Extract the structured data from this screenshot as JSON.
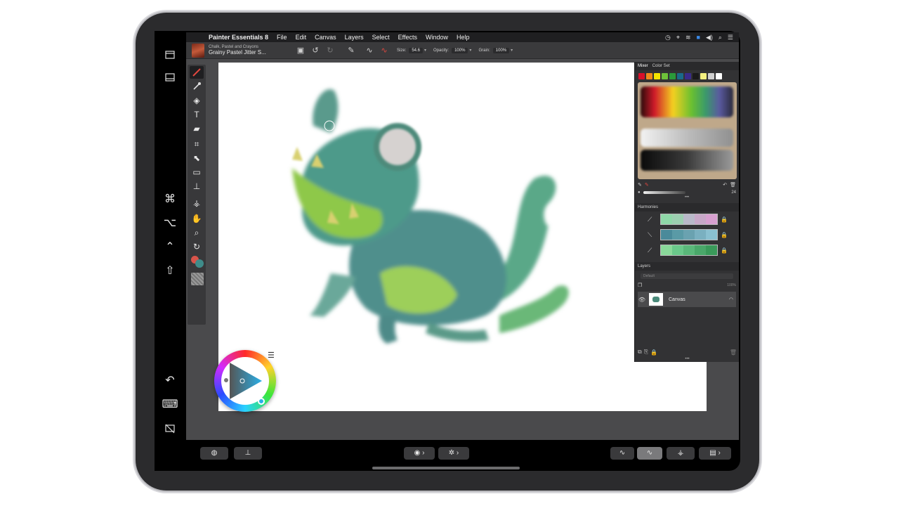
{
  "menubar": {
    "app_name": "Painter Essentials 8",
    "menus": [
      "File",
      "Edit",
      "Canvas",
      "Layers",
      "Select",
      "Effects",
      "Window",
      "Help"
    ]
  },
  "property_bar": {
    "brush_category": "Chalk, Pastel and Crayons",
    "brush_variant": "Grainy Pastel Jitter S...",
    "size_label": "Size:",
    "size_value": "54.6",
    "opacity_label": "Opacity:",
    "opacity_value": "100%",
    "grain_label": "Grain:",
    "grain_value": "100%"
  },
  "panels": {
    "mixer_tab": "Mixer",
    "color_set_tab": "Color Set",
    "mixer_value": "24",
    "harmonies_title": "Harmonies",
    "layers_title": "Layers",
    "layers_composite": "Default",
    "layers_opacity": "100%",
    "layer_name": "Canvas"
  },
  "colors": {
    "mixer_swatches": [
      "#d9102a",
      "#f08a1c",
      "#f4e400",
      "#6ec23a",
      "#2a9a3a",
      "#1a6a8a",
      "#3a2a8a",
      "#1a1a1a",
      "#f4f080",
      "#d0d0d0",
      "#ffffff"
    ],
    "harmony_rows": [
      [
        "#8fd8a8",
        "#9ccfb0",
        "#b9b9c9",
        "#c8a8c8",
        "#d8a0d0"
      ],
      [
        "#4a8a9a",
        "#5a9aa6",
        "#6aa2b0",
        "#7ab0c0",
        "#8ac0d0"
      ],
      [
        "#8ad89a",
        "#6ac88a",
        "#5ab87a",
        "#4aa86a",
        "#3a9a5a"
      ]
    ],
    "harmony_lock_colors": [
      "#d0303a",
      "#e8e8e8",
      "#d0303a"
    ],
    "primary": "#d8544a",
    "secondary": "#3f8c8a"
  }
}
